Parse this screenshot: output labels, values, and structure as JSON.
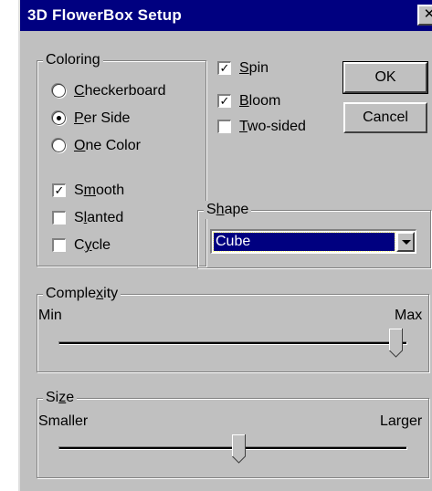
{
  "window": {
    "title": "3D FlowerBox Setup",
    "close_glyph": "✕"
  },
  "coloring": {
    "legend": "Coloring",
    "radios": [
      {
        "pre": "",
        "key": "C",
        "post": "heckerboard",
        "selected": false
      },
      {
        "pre": "",
        "key": "P",
        "post": "er Side",
        "selected": true
      },
      {
        "pre": "",
        "key": "O",
        "post": "ne Color",
        "selected": false
      }
    ],
    "checks": [
      {
        "pre": "S",
        "key": "m",
        "post": "ooth",
        "checked": true
      },
      {
        "pre": "S",
        "key": "l",
        "post": "anted",
        "checked": false
      },
      {
        "pre": "C",
        "key": "y",
        "post": "cle",
        "checked": false
      }
    ]
  },
  "options": [
    {
      "pre": "",
      "key": "S",
      "post": "pin",
      "checked": true
    },
    {
      "pre": "",
      "key": "B",
      "post": "loom",
      "checked": true
    },
    {
      "pre": "",
      "key": "T",
      "post": "wo-sided",
      "checked": false
    }
  ],
  "buttons": {
    "ok": "OK",
    "cancel": "Cancel"
  },
  "shape": {
    "legend_pre": "S",
    "legend_key": "h",
    "legend_post": "ape",
    "value": "Cube"
  },
  "complexity": {
    "legend_pre": "Comple",
    "legend_key": "x",
    "legend_post": "ity",
    "min": "Min",
    "max": "Max",
    "level": 1.0
  },
  "size": {
    "legend_pre": "Si",
    "legend_key": "z",
    "legend_post": "e",
    "min": "Smaller",
    "max": "Larger",
    "level": 0.52
  },
  "colors": {
    "face": "#c0c0c0",
    "title": "#000080",
    "highlight": "#000080"
  }
}
